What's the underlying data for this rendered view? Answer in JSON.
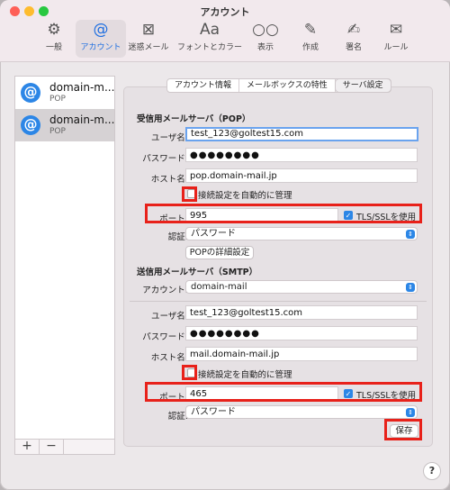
{
  "window": {
    "title": "アカウント"
  },
  "toolbar": {
    "items": [
      {
        "label": "一般",
        "icon": "gear-icon",
        "glyph": "⚙"
      },
      {
        "label": "アカウント",
        "icon": "at-icon",
        "glyph": "@"
      },
      {
        "label": "迷惑メール",
        "icon": "junk-icon",
        "glyph": "⊠"
      },
      {
        "label": "フォントとカラー",
        "icon": "font-icon",
        "glyph": "Aa"
      },
      {
        "label": "表示",
        "icon": "glasses-icon",
        "glyph": "○○"
      },
      {
        "label": "作成",
        "icon": "compose-icon",
        "glyph": "✎"
      },
      {
        "label": "署名",
        "icon": "signature-icon",
        "glyph": "✍"
      },
      {
        "label": "ルール",
        "icon": "rules-icon",
        "glyph": "✉"
      }
    ]
  },
  "sidebar": {
    "accounts": [
      {
        "name": "domain-m...",
        "protocol": "POP",
        "badge": "@"
      },
      {
        "name": "domain-m...",
        "protocol": "POP",
        "badge": "@"
      }
    ],
    "add_label": "+",
    "remove_label": "−"
  },
  "tabs": [
    "アカウント情報",
    "メールボックスの特性",
    "サーバ設定"
  ],
  "incoming": {
    "section_title": "受信用メールサーバ（POP）",
    "username_label": "ユーザ名:",
    "username": "test_123@goltest15.com",
    "password_label": "パスワード:",
    "password": "●●●●●●●●",
    "host_label": "ホスト名:",
    "host": "pop.domain-mail.jp",
    "auto_manage_label": "接続設定を自動的に管理",
    "port_label": "ポート:",
    "port": "995",
    "tls_label": "TLS/SSLを使用",
    "auth_label": "認証:",
    "auth_value": "パスワード",
    "advanced_button": "POPの詳細設定"
  },
  "outgoing": {
    "section_title": "送信用メールサーバ（SMTP）",
    "account_label": "アカウント:",
    "account_value": "domain-mail",
    "username_label": "ユーザ名:",
    "username": "test_123@goltest15.com",
    "password_label": "パスワード:",
    "password": "●●●●●●●●",
    "host_label": "ホスト名:",
    "host": "mail.domain-mail.jp",
    "auto_manage_label": "接続設定を自動的に管理",
    "port_label": "ポート:",
    "port": "465",
    "tls_label": "TLS/SSLを使用",
    "auth_label": "認証:",
    "auth_value": "パスワード"
  },
  "save_button": "保存",
  "help_label": "?",
  "colors": {
    "accent": "#2c86e6",
    "highlight": "#e8211a"
  }
}
